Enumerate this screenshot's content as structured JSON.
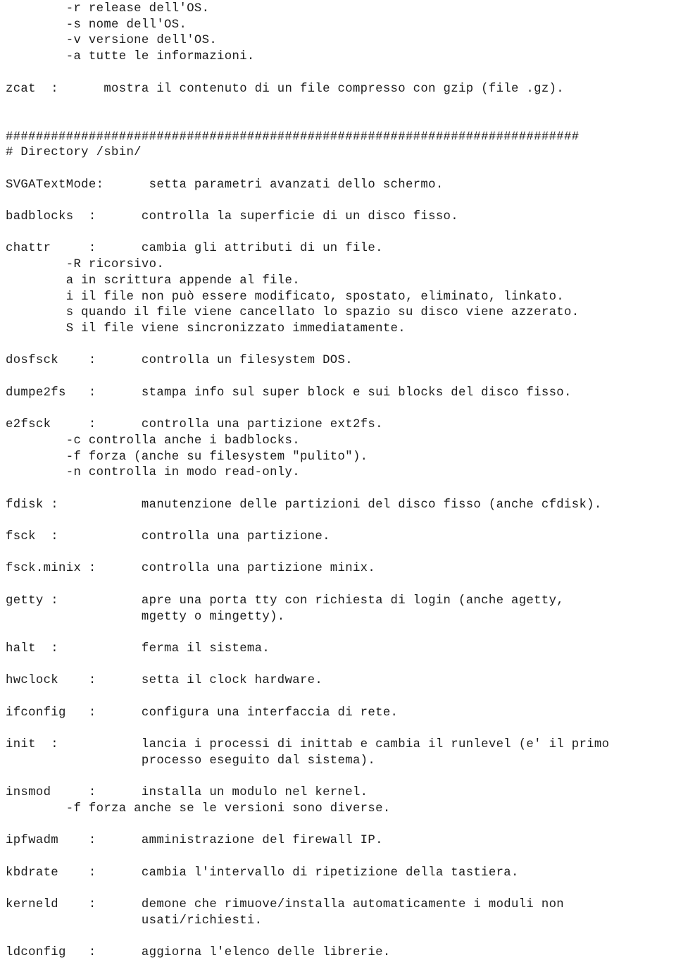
{
  "document": {
    "kind": "plain-text-manual-page",
    "language": "it",
    "text_color": "#1c1c1c",
    "background_color": "#ffffff",
    "section_heading": "# Directory /sbin/",
    "separator_rule": "############################################################################",
    "lines": [
      "        -r release dell'OS.",
      "        -s nome dell'OS.",
      "        -v versione dell'OS.",
      "        -a tutte le informazioni.",
      "",
      "zcat  :      mostra il contenuto di un file compresso con gzip (file .gz).",
      "",
      "",
      "############################################################################",
      "# Directory /sbin/",
      "",
      "SVGATextMode:      setta parametri avanzati dello schermo.",
      "",
      "badblocks  :      controlla la superficie di un disco fisso.",
      "",
      "chattr     :      cambia gli attributi di un file.",
      "        -R ricorsivo.",
      "        a in scrittura appende al file.",
      "        i il file non può essere modificato, spostato, eliminato, linkato.",
      "        s quando il file viene cancellato lo spazio su disco viene azzerato.",
      "        S il file viene sincronizzato immediatamente.",
      "",
      "dosfsck    :      controlla un filesystem DOS.",
      "",
      "dumpe2fs   :      stampa info sul super block e sui blocks del disco fisso.",
      "",
      "e2fsck     :      controlla una partizione ext2fs.",
      "        -c controlla anche i badblocks.",
      "        -f forza (anche su filesystem \"pulito\").",
      "        -n controlla in modo read-only.",
      "",
      "fdisk :           manutenzione delle partizioni del disco fisso (anche cfdisk).",
      "",
      "fsck  :           controlla una partizione.",
      "",
      "fsck.minix :      controlla una partizione minix.",
      "",
      "getty :           apre una porta tty con richiesta di login (anche agetty,",
      "                  mgetty o mingetty).",
      "",
      "halt  :           ferma il sistema.",
      "",
      "hwclock    :      setta il clock hardware.",
      "",
      "ifconfig   :      configura una interfaccia di rete.",
      "",
      "init  :           lancia i processi di inittab e cambia il runlevel (e' il primo",
      "                  processo eseguito dal sistema).",
      "",
      "insmod     :      installa un modulo nel kernel.",
      "        -f forza anche se le versioni sono diverse.",
      "",
      "ipfwadm    :      amministrazione del firewall IP.",
      "",
      "kbdrate    :      cambia l'intervallo di ripetizione della tastiera.",
      "",
      "kerneld    :      demone che rimuove/installa automaticamente i moduli non",
      "                  usati/richiesti.",
      "",
      "ldconfig   :      aggiorna l'elenco delle librerie."
    ],
    "entries": [
      {
        "command": "zcat",
        "separator": ":",
        "description": "mostra il contenuto di un file compresso con gzip (file .gz)."
      },
      {
        "command": "SVGATextMode:",
        "separator": "",
        "description": "setta parametri avanzati dello schermo."
      },
      {
        "command": "badblocks",
        "separator": ":",
        "description": "controlla la superficie di un disco fisso."
      },
      {
        "command": "chattr",
        "separator": ":",
        "description": "cambia gli attributi di un file.",
        "options": [
          "-R ricorsivo.",
          "a in scrittura appende al file.",
          "i il file non può essere modificato, spostato, eliminato, linkato.",
          "s quando il file viene cancellato lo spazio su disco viene azzerato.",
          "S il file viene sincronizzato immediatamente."
        ]
      },
      {
        "command": "dosfsck",
        "separator": ":",
        "description": "controlla un filesystem DOS."
      },
      {
        "command": "dumpe2fs",
        "separator": ":",
        "description": "stampa info sul super block e sui blocks del disco fisso."
      },
      {
        "command": "e2fsck",
        "separator": ":",
        "description": "controlla una partizione ext2fs.",
        "options": [
          "-c controlla anche i badblocks.",
          "-f forza (anche su filesystem \"pulito\").",
          "-n controlla in modo read-only."
        ]
      },
      {
        "command": "fdisk",
        "separator": ":",
        "description": "manutenzione delle partizioni del disco fisso (anche cfdisk)."
      },
      {
        "command": "fsck",
        "separator": ":",
        "description": "controlla una partizione."
      },
      {
        "command": "fsck.minix",
        "separator": ":",
        "description": "controlla una partizione minix."
      },
      {
        "command": "getty",
        "separator": ":",
        "description": "apre una porta tty con richiesta di login (anche agetty, mgetty o mingetty)."
      },
      {
        "command": "halt",
        "separator": ":",
        "description": "ferma il sistema."
      },
      {
        "command": "hwclock",
        "separator": ":",
        "description": "setta il clock hardware."
      },
      {
        "command": "ifconfig",
        "separator": ":",
        "description": "configura una interfaccia di rete."
      },
      {
        "command": "init",
        "separator": ":",
        "description": "lancia i processi di inittab e cambia il runlevel (e' il primo processo eseguito dal sistema)."
      },
      {
        "command": "insmod",
        "separator": ":",
        "description": "installa un modulo nel kernel.",
        "options": [
          "-f forza anche se le versioni sono diverse."
        ]
      },
      {
        "command": "ipfwadm",
        "separator": ":",
        "description": "amministrazione del firewall IP."
      },
      {
        "command": "kbdrate",
        "separator": ":",
        "description": "cambia l'intervallo di ripetizione della tastiera."
      },
      {
        "command": "kerneld",
        "separator": ":",
        "description": "demone che rimuove/installa automaticamente i moduli non usati/richiesti."
      },
      {
        "command": "ldconfig",
        "separator": ":",
        "description": "aggiorna l'elenco delle librerie."
      }
    ],
    "leading_uname_options": [
      "-r release dell'OS.",
      "-s nome dell'OS.",
      "-v versione dell'OS.",
      "-a tutte le informazioni."
    ]
  }
}
